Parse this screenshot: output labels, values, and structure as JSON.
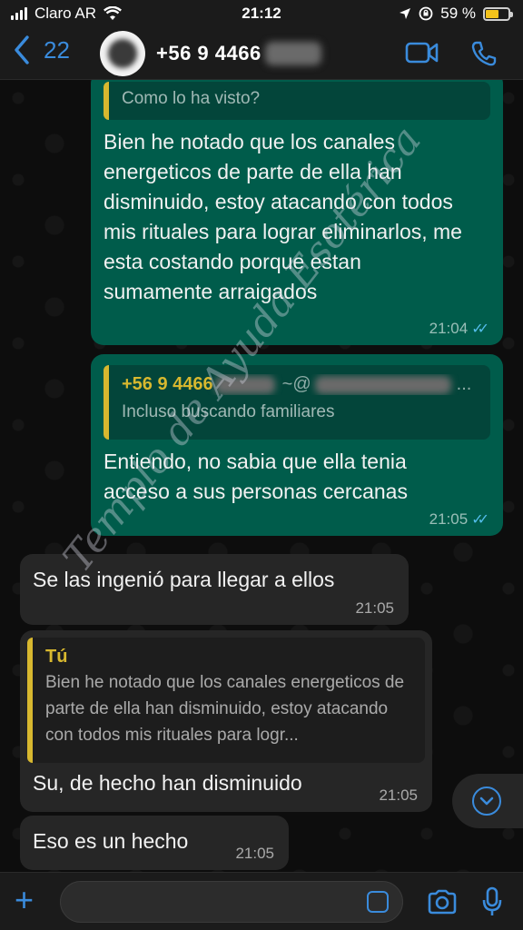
{
  "status": {
    "carrier": "Claro AR",
    "time": "21:12",
    "battery": "59 %",
    "battery_level": 0.59
  },
  "header": {
    "back_count": "22",
    "contact": "+56 9 4466"
  },
  "messages": [
    {
      "dir": "out",
      "quote_text": "Como lo ha visto?",
      "text": "Bien he notado que los canales energeticos de parte de ella han disminuido, estoy atacando con todos mis rituales para lograr eliminarlos, me esta costando porque estan sumamente arraigados",
      "time": "21:04"
    },
    {
      "dir": "out",
      "quote_author": "+56 9 4466",
      "quote_author_suffix": "~@",
      "quote_text": "Incluso buscando familiares",
      "text": "Entiendo, no sabia que ella tenia acceso a sus personas cercanas",
      "time": "21:05"
    },
    {
      "dir": "in",
      "text": "Se las ingenió para llegar a ellos",
      "time": "21:05"
    },
    {
      "dir": "in",
      "quote_author": "Tú",
      "quote_text": "Bien he notado que los canales energeticos de parte de ella han disminuido, estoy atacando con todos mis rituales para logr...",
      "text": "Su, de hecho han disminuido",
      "time": "21:05"
    },
    {
      "dir": "in",
      "text": "Eso es un hecho",
      "time": "21:05"
    }
  ],
  "watermark": "Templo de Ayuda Esotérica",
  "colors": {
    "accent": "#3a8bdc",
    "outgoing": "#005c4b",
    "incoming": "#262626",
    "quote_bar": "#d8b82f",
    "read_ticks": "#53bdeb"
  }
}
